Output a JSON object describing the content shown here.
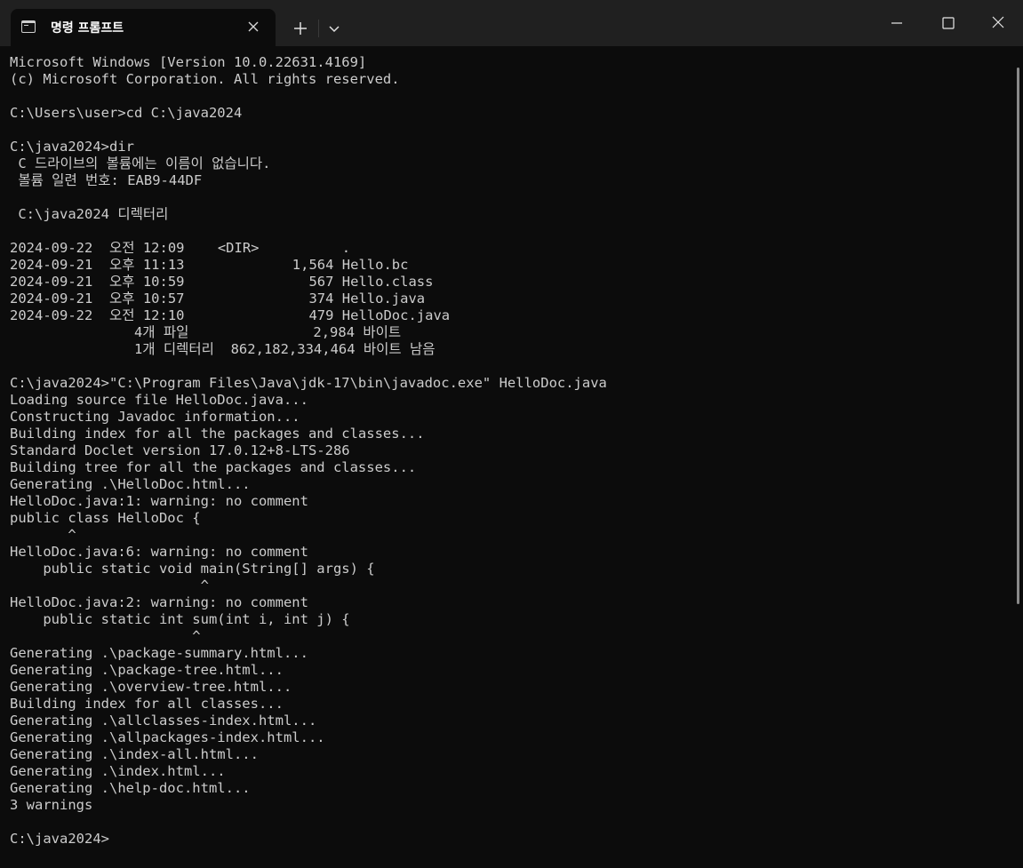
{
  "window": {
    "tab_title": "명령 프롬프트",
    "icons": {
      "tab": "console-icon",
      "close_tab": "close-icon",
      "new_tab": "plus-icon",
      "dropdown": "chevron-down-icon",
      "minimize": "minimize-icon",
      "maximize": "maximize-icon",
      "close_window": "close-icon"
    },
    "colors": {
      "titlebar": "#202020",
      "background": "#0c0c0c",
      "text": "#cccccc"
    }
  },
  "console": {
    "lines": [
      "Microsoft Windows [Version 10.0.22631.4169]",
      "(c) Microsoft Corporation. All rights reserved.",
      "",
      "C:\\Users\\user>cd C:\\java2024",
      "",
      "C:\\java2024>dir",
      " C 드라이브의 볼륨에는 이름이 없습니다.",
      " 볼륨 일련 번호: EAB9-44DF",
      "",
      " C:\\java2024 디렉터리",
      "",
      "2024-09-22  오전 12:09    <DIR>          .",
      "2024-09-21  오후 11:13             1,564 Hello.bc",
      "2024-09-21  오후 10:59               567 Hello.class",
      "2024-09-21  오후 10:57               374 Hello.java",
      "2024-09-22  오전 12:10               479 HelloDoc.java",
      "               4개 파일               2,984 바이트",
      "               1개 디렉터리  862,182,334,464 바이트 남음",
      "",
      "C:\\java2024>\"C:\\Program Files\\Java\\jdk-17\\bin\\javadoc.exe\" HelloDoc.java",
      "Loading source file HelloDoc.java...",
      "Constructing Javadoc information...",
      "Building index for all the packages and classes...",
      "Standard Doclet version 17.0.12+8-LTS-286",
      "Building tree for all the packages and classes...",
      "Generating .\\HelloDoc.html...",
      "HelloDoc.java:1: warning: no comment",
      "public class HelloDoc {",
      "       ^",
      "HelloDoc.java:6: warning: no comment",
      "    public static void main(String[] args) {",
      "                       ^",
      "HelloDoc.java:2: warning: no comment",
      "    public static int sum(int i, int j) {",
      "                      ^",
      "Generating .\\package-summary.html...",
      "Generating .\\package-tree.html...",
      "Generating .\\overview-tree.html...",
      "Building index for all classes...",
      "Generating .\\allclasses-index.html...",
      "Generating .\\allpackages-index.html...",
      "Generating .\\index-all.html...",
      "Generating .\\index.html...",
      "Generating .\\help-doc.html...",
      "3 warnings",
      "",
      "C:\\java2024>"
    ]
  }
}
